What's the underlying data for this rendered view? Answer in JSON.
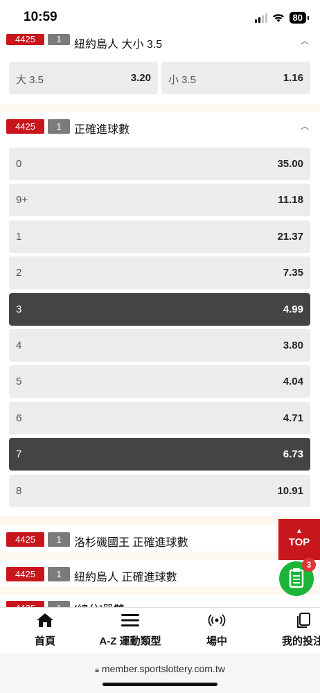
{
  "status": {
    "time": "10:59",
    "battery": "80"
  },
  "section1": {
    "code": "4425",
    "num": "1",
    "title": "紐約島人 大小 3.5",
    "options": [
      {
        "label": "大 3.5",
        "value": "3.20"
      },
      {
        "label": "小 3.5",
        "value": "1.16"
      }
    ]
  },
  "section2": {
    "code": "4425",
    "num": "1",
    "title": "正確進球數",
    "rows": [
      {
        "label": "0",
        "value": "35.00",
        "selected": false
      },
      {
        "label": "9+",
        "value": "11.18",
        "selected": false
      },
      {
        "label": "1",
        "value": "21.37",
        "selected": false
      },
      {
        "label": "2",
        "value": "7.35",
        "selected": false
      },
      {
        "label": "3",
        "value": "4.99",
        "selected": true
      },
      {
        "label": "4",
        "value": "3.80",
        "selected": false
      },
      {
        "label": "5",
        "value": "4.04",
        "selected": false
      },
      {
        "label": "6",
        "value": "4.71",
        "selected": false
      },
      {
        "label": "7",
        "value": "6.73",
        "selected": true
      },
      {
        "label": "8",
        "value": "10.91",
        "selected": false
      }
    ]
  },
  "collapsed": [
    {
      "code": "4425",
      "num": "1",
      "title": "洛杉磯國王 正確進球數"
    },
    {
      "code": "4425",
      "num": "1",
      "title": "紐約島人 正確進球數"
    },
    {
      "code": "4425",
      "num": "1",
      "title": "[總分]單雙"
    }
  ],
  "floating": {
    "top_label": "TOP",
    "slip_count": "3"
  },
  "nav": {
    "home": "首頁",
    "az": "A-Z 運動類型",
    "live": "場中",
    "bets": "我的投注"
  },
  "browser": {
    "url": "member.sportslottery.com.tw"
  },
  "colors": {
    "brand_red": "#c8161d",
    "selected_bg": "#444444",
    "slip_green": "#1cb43a"
  }
}
